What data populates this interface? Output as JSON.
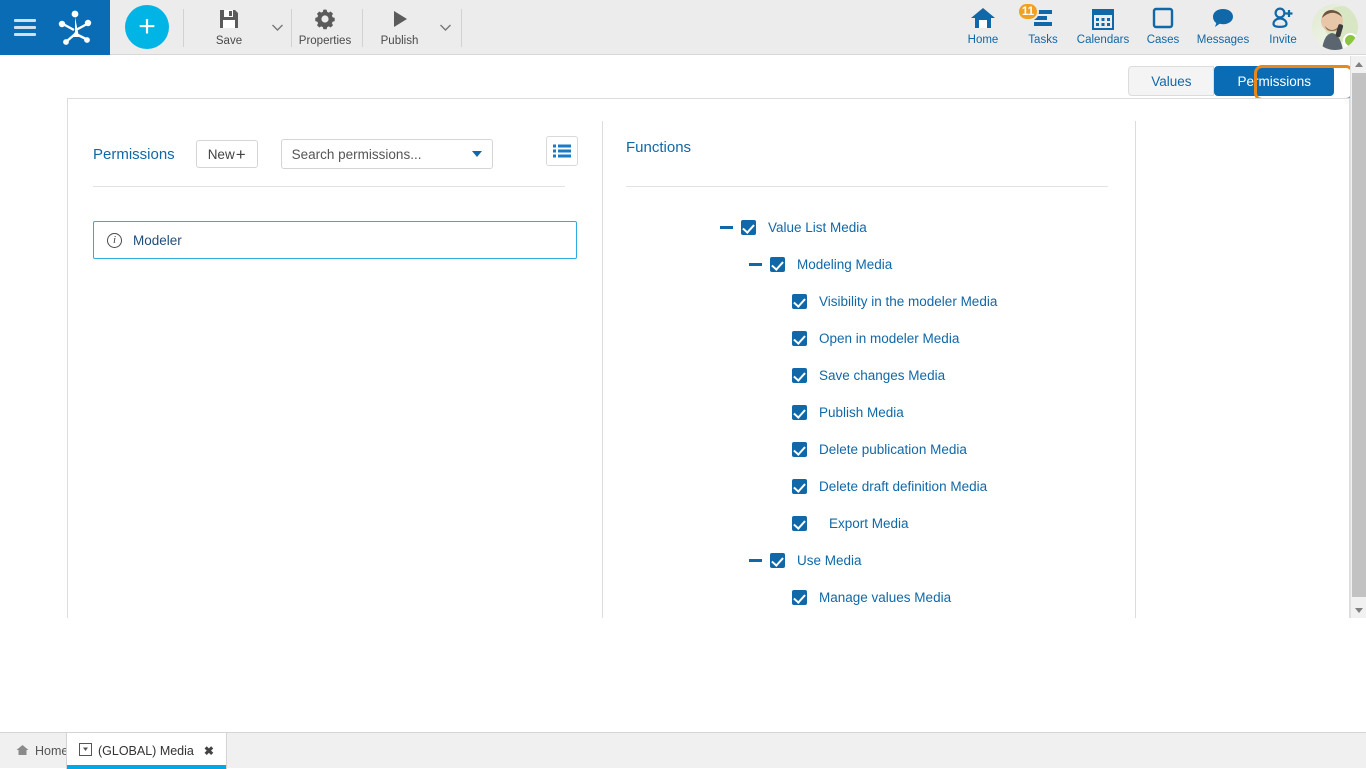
{
  "topbar": {
    "menu_icon": "hamburger-icon",
    "logo_icon": "app-logo-icon",
    "add_label": "+",
    "tools": [
      {
        "id": "save",
        "label": "Save",
        "icon": "save-icon",
        "has_caret": true
      },
      {
        "id": "properties",
        "label": "Properties",
        "icon": "gear-icon",
        "has_caret": false
      },
      {
        "id": "publish",
        "label": "Publish",
        "icon": "play-icon",
        "has_caret": true
      }
    ],
    "nav": [
      {
        "id": "home",
        "label": "Home",
        "icon": "home-icon",
        "badge": ""
      },
      {
        "id": "tasks",
        "label": "Tasks",
        "icon": "tasks-icon",
        "badge": "11"
      },
      {
        "id": "calendars",
        "label": "Calendars",
        "icon": "calendar-icon",
        "badge": ""
      },
      {
        "id": "cases",
        "label": "Cases",
        "icon": "cases-square-icon",
        "badge": ""
      },
      {
        "id": "messages",
        "label": "Messages",
        "icon": "speech-bubble-icon",
        "badge": ""
      },
      {
        "id": "invite",
        "label": "Invite",
        "icon": "person-add-icon",
        "badge": ""
      }
    ],
    "avatar": {
      "name": "avatar",
      "status": "online"
    }
  },
  "tabs": {
    "values_label": "Values",
    "permissions_label": "Permissions",
    "active": "Permissions",
    "highlight_color": "#e8881a"
  },
  "left_panel": {
    "title": "Permissions",
    "new_button": "New",
    "new_button_plus": "+",
    "search": {
      "placeholder": "Search permissions...",
      "value": ""
    },
    "list_view_icon": "list-view-icon",
    "items": [
      {
        "label": "Modeler",
        "icon": "info-icon",
        "selected": true
      }
    ]
  },
  "right_panel": {
    "title": "Functions",
    "tree": [
      {
        "label": "Value List Media",
        "level": 0,
        "checked": true,
        "expandable": true,
        "wide": false
      },
      {
        "label": "Modeling Media",
        "level": 1,
        "checked": true,
        "expandable": true,
        "wide": false
      },
      {
        "label": "Visibility in the modeler Media",
        "level": 2,
        "checked": true,
        "expandable": false,
        "wide": false
      },
      {
        "label": "Open in modeler Media",
        "level": 2,
        "checked": true,
        "expandable": false,
        "wide": false
      },
      {
        "label": "Save changes Media",
        "level": 2,
        "checked": true,
        "expandable": false,
        "wide": false
      },
      {
        "label": "Publish Media",
        "level": 2,
        "checked": true,
        "expandable": false,
        "wide": false
      },
      {
        "label": "Delete publication Media",
        "level": 2,
        "checked": true,
        "expandable": false,
        "wide": false
      },
      {
        "label": "Delete draft definition Media",
        "level": 2,
        "checked": true,
        "expandable": false,
        "wide": false
      },
      {
        "label": "Export Media",
        "level": 2,
        "checked": true,
        "expandable": false,
        "wide": true
      },
      {
        "label": "Use Media",
        "level": 1,
        "checked": true,
        "expandable": true,
        "wide": false
      },
      {
        "label": "Manage values Media",
        "level": 2,
        "checked": true,
        "expandable": false,
        "wide": false
      }
    ]
  },
  "taskbar": {
    "items": [
      {
        "label": "Home",
        "icon": "home-small-icon",
        "active": false,
        "closable": false
      },
      {
        "label": "(GLOBAL) Media",
        "icon": "doc-small-icon",
        "active": true,
        "closable": true,
        "close": "✖"
      }
    ]
  },
  "colors": {
    "brand_blue": "#0a6cb4",
    "accent_cyan": "#00b4e5",
    "highlight_orange": "#e8881a",
    "badge_orange": "#f0a022",
    "status_green": "#8cc63e"
  }
}
